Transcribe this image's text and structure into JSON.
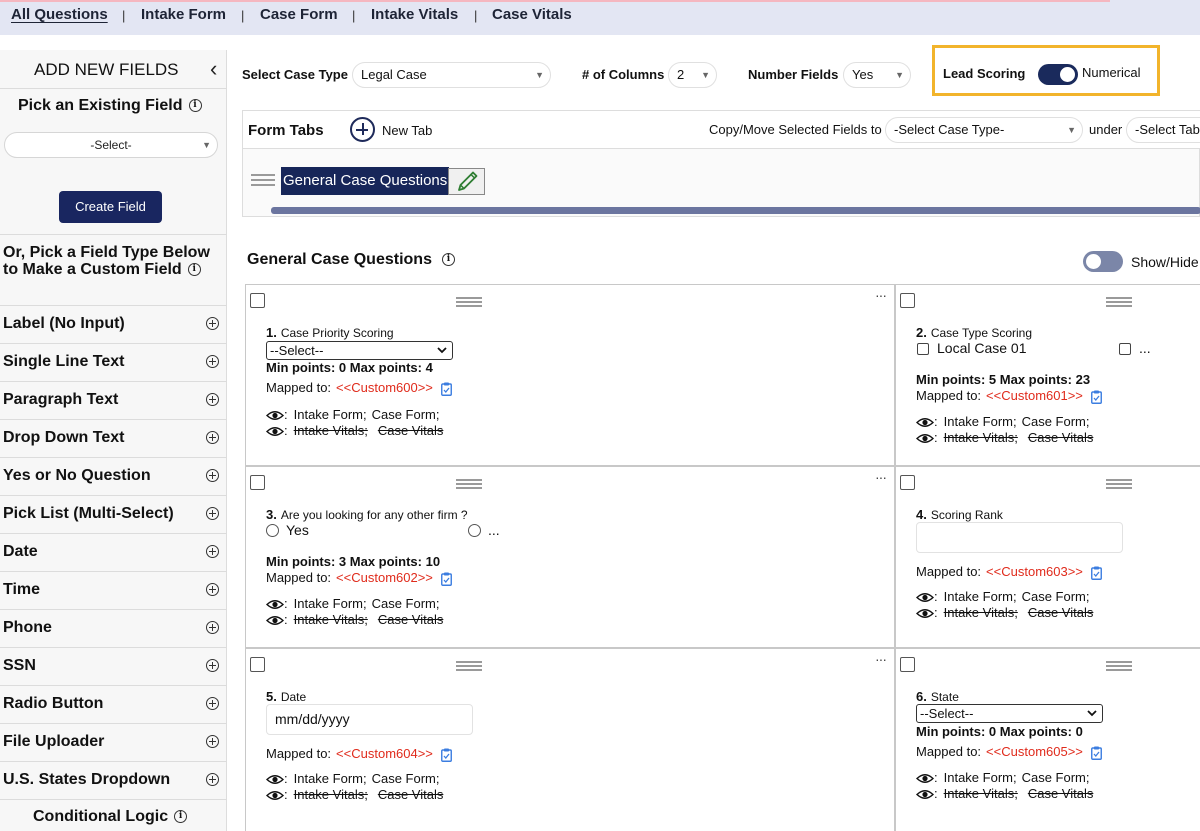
{
  "nav": {
    "tabs": [
      "All Questions",
      "Intake Form",
      "Case Form",
      "Intake Vitals",
      "Case Vitals"
    ],
    "separator": "|"
  },
  "sidebar": {
    "title": "ADD NEW FIELDS",
    "collapse_icon": "‹",
    "pick_existing": "Pick an Existing Field",
    "select_value": "-Select-",
    "create_button": "Create Field",
    "or_pick": "Or, Pick a Field Type Below to Make a Custom Field",
    "field_types": [
      "Label (No Input)",
      "Single Line Text",
      "Paragraph Text",
      "Drop Down Text",
      "Yes or No Question",
      "Pick List (Multi-Select)",
      "Date",
      "Time",
      "Phone",
      "SSN",
      "Radio Button",
      "File Uploader",
      "U.S. States Dropdown"
    ],
    "conditional_logic": "Conditional Logic"
  },
  "settings": {
    "case_type_label": "Select Case Type",
    "case_type_value": "Legal Case",
    "columns_label": "# of Columns",
    "columns_value": "2",
    "number_fields_label": "Number Fields",
    "number_fields_value": "Yes",
    "lead_scoring_label": "Lead Scoring",
    "lead_scoring_mode": "Numerical",
    "lead_scoring_on": true
  },
  "form_tabs": {
    "label": "Form Tabs",
    "new_tab": "New Tab",
    "copy_move_label": "Copy/Move Selected Fields to",
    "copy_case_type": "-Select Case Type-",
    "under_label": "under",
    "under_value": "-Select Tab-",
    "tabs": [
      "General Case Questions"
    ]
  },
  "section": {
    "title": "General Case Questions",
    "show_hide_label": "Show/Hide"
  },
  "common": {
    "mapped_to": "Mapped to:",
    "eye_sep": ":",
    "visible_forms": [
      "Intake Form;",
      "Case Form;"
    ],
    "hidden_forms": [
      "Intake Vitals;",
      "Case Vitals"
    ],
    "more": "···"
  },
  "questions": [
    {
      "num": "1.",
      "title": "Case Priority Scoring",
      "select_value": "--Select--",
      "points": "Min points: 0 Max points: 4",
      "custom": "<<Custom600>>"
    },
    {
      "num": "2.",
      "title": "Case Type Scoring",
      "option1": "Local Case 01",
      "option2": "...",
      "points": "Min points: 5 Max points: 23",
      "custom": "<<Custom601>>"
    },
    {
      "num": "3.",
      "title": "Are you looking for any other firm ?",
      "option1": "Yes",
      "option2": "...",
      "points": "Min points: 3 Max points: 10",
      "custom": "<<Custom602>>"
    },
    {
      "num": "4.",
      "title": "Scoring Rank",
      "custom": "<<Custom603>>"
    },
    {
      "num": "5.",
      "title": "Date",
      "placeholder": "mm/dd/yyyy",
      "custom": "<<Custom604>>"
    },
    {
      "num": "6.",
      "title": "State",
      "select_value": "--Select--",
      "points": "Min points: 0 Max points: 0",
      "custom": "<<Custom605>>"
    }
  ],
  "colors": {
    "nav_bg": "#e3e6f3",
    "primary": "#192660",
    "highlight": "#f2b42b",
    "custom_red": "#e02b1c",
    "clip_blue": "#3b7de0"
  }
}
